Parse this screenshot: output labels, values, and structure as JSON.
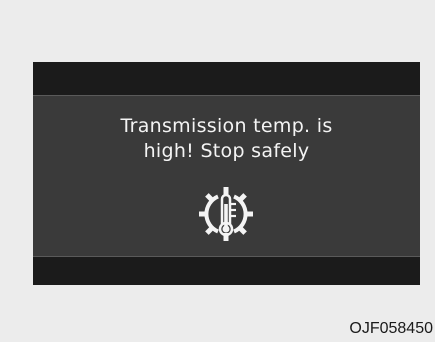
{
  "display": {
    "message_line1": "Transmission temp. is",
    "message_line2": "high! Stop safely",
    "icon": "transmission-temperature-warning-icon"
  },
  "caption": {
    "code": "OJF058450"
  },
  "colors": {
    "panel_background": "#3a3a3a",
    "bar_background": "#1b1b1b",
    "text": "#f4f4f4",
    "page_background": "#ececec"
  }
}
